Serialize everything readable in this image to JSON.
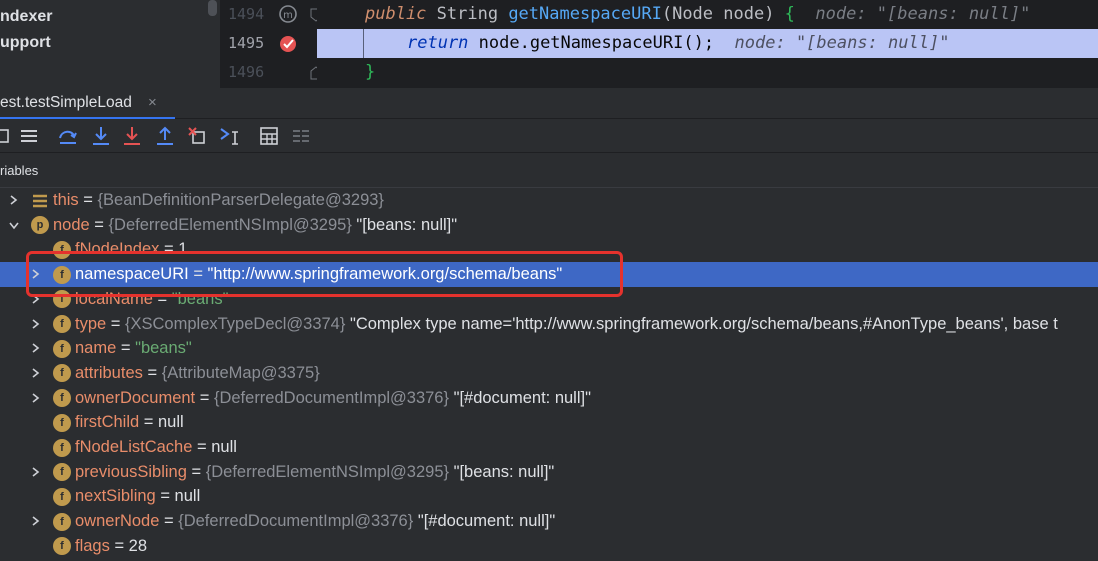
{
  "project": {
    "items": [
      "ndexer",
      "upport"
    ]
  },
  "editor": {
    "lines": [
      {
        "number": "1494",
        "keyword": "public",
        "text": " String ",
        "method": "getNamespaceURI",
        "rest": "(Node node) ",
        "brace": "{",
        "hint": "  node: \"[beans: null]\""
      },
      {
        "number": "1495",
        "keyword": "return",
        "text": " node.getNamespaceURI();",
        "hint": "  node: \"[beans: null]\""
      },
      {
        "number": "1496",
        "brace": "}"
      }
    ]
  },
  "debug": {
    "tab_label": "est.testSimpleLoad",
    "tab_close": "×",
    "variables_title": "riables"
  },
  "toolbar": {
    "buttons": [
      "restore-layout",
      "step-over",
      "step-into",
      "force-step-into",
      "step-out",
      "drop-frame",
      "run-to-cursor",
      "evaluate-expression",
      "trace-stream"
    ]
  },
  "tree": {
    "rows": [
      {
        "name": "this",
        "eq": " = ",
        "type": "{BeanDefinitionParserDelegate@3293}",
        "value": ""
      },
      {
        "name": "node",
        "eq": " = ",
        "type": "{DeferredElementNSImpl@3295}",
        "value": " \"[beans: null]\""
      },
      {
        "name": "fNodeIndex",
        "eq": " = ",
        "type": "",
        "value": "1"
      },
      {
        "name": "namespaceURI",
        "eq": " = ",
        "type": "",
        "value": "\"http://www.springframework.org/schema/beans\""
      },
      {
        "name": "localName",
        "eq": " = ",
        "type": "",
        "value": "\"beans\""
      },
      {
        "name": "type",
        "eq": " = ",
        "type": "{XSComplexTypeDecl@3374}",
        "value": " \"Complex type name='http://www.springframework.org/schema/beans,#AnonType_beans',  base t"
      },
      {
        "name": "name",
        "eq": " = ",
        "type": "",
        "value": "\"beans\""
      },
      {
        "name": "attributes",
        "eq": " = ",
        "type": "{AttributeMap@3375}",
        "value": ""
      },
      {
        "name": "ownerDocument",
        "eq": " = ",
        "type": "{DeferredDocumentImpl@3376}",
        "value": " \"[#document: null]\""
      },
      {
        "name": "firstChild",
        "eq": " = ",
        "type": "",
        "value": "null"
      },
      {
        "name": "fNodeListCache",
        "eq": " = ",
        "type": "",
        "value": "null"
      },
      {
        "name": "previousSibling",
        "eq": " = ",
        "type": "{DeferredElementNSImpl@3295}",
        "value": " \"[beans: null]\""
      },
      {
        "name": "nextSibling",
        "eq": " = ",
        "type": "",
        "value": "null"
      },
      {
        "name": "ownerNode",
        "eq": " = ",
        "type": "{DeferredDocumentImpl@3376}",
        "value": " \"[#document: null]\""
      },
      {
        "name": "flags",
        "eq": " = ",
        "type": "",
        "value": "28"
      }
    ]
  },
  "colors": {
    "selection": "#3e68c5",
    "field_icon": "#c09a4d",
    "annotation": "#e5322d",
    "string": "#6aab73",
    "name": "#e98d6a"
  }
}
